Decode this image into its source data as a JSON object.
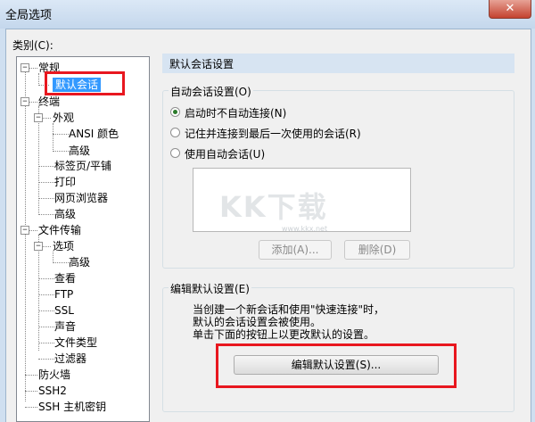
{
  "window": {
    "title": "全局选项",
    "close_glyph": "✕"
  },
  "category_label": "类别(C):",
  "tree": {
    "nodes": [
      {
        "id": "general",
        "label": "常规"
      },
      {
        "id": "default-session",
        "label": "默认会话",
        "selected": true
      },
      {
        "id": "terminal",
        "label": "终端"
      },
      {
        "id": "appearance",
        "label": "外观"
      },
      {
        "id": "ansi-color",
        "label": "ANSI 颜色"
      },
      {
        "id": "appearance-advanced",
        "label": "高级"
      },
      {
        "id": "tabs",
        "label": "标签页/平铺"
      },
      {
        "id": "print",
        "label": "打印"
      },
      {
        "id": "web-browser",
        "label": "网页浏览器"
      },
      {
        "id": "terminal-advanced",
        "label": "高级"
      },
      {
        "id": "file-transfer",
        "label": "文件传输"
      },
      {
        "id": "options",
        "label": "选项"
      },
      {
        "id": "options-advanced",
        "label": "高级"
      },
      {
        "id": "view",
        "label": "查看"
      },
      {
        "id": "ftp",
        "label": "FTP"
      },
      {
        "id": "ssl",
        "label": "SSL"
      },
      {
        "id": "sound",
        "label": "声音"
      },
      {
        "id": "file-types",
        "label": "文件类型"
      },
      {
        "id": "filters",
        "label": "过滤器"
      },
      {
        "id": "firewall",
        "label": "防火墙"
      },
      {
        "id": "ssh2",
        "label": "SSH2"
      },
      {
        "id": "ssh-host-keys",
        "label": "SSH 主机密钥"
      }
    ]
  },
  "panel": {
    "header": "默认会话设置",
    "auto_group": {
      "legend": "自动会话设置(O)",
      "radios": [
        {
          "label": "启动时不自动连接(N)",
          "checked": true
        },
        {
          "label": "记住并连接到最后一次使用的会话(R)",
          "checked": false
        },
        {
          "label": "使用自动会话(U)",
          "checked": false
        }
      ],
      "add_button": "添加(A)...",
      "delete_button": "删除(D)"
    },
    "edit_group": {
      "legend": "编辑默认设置(E)",
      "description": [
        "当创建一个新会话和使用\"快速连接\"时，",
        "默认的会话设置会被使用。",
        "单击下面的按钮上以更改默认的设置。"
      ],
      "edit_button": "编辑默认设置(S)..."
    }
  },
  "watermark": {
    "text": "KK下载",
    "url": "www.kkx.net"
  },
  "colors": {
    "highlight": "#e8171f",
    "selection": "#3399ff",
    "header_bg": "#d7e4f2"
  }
}
